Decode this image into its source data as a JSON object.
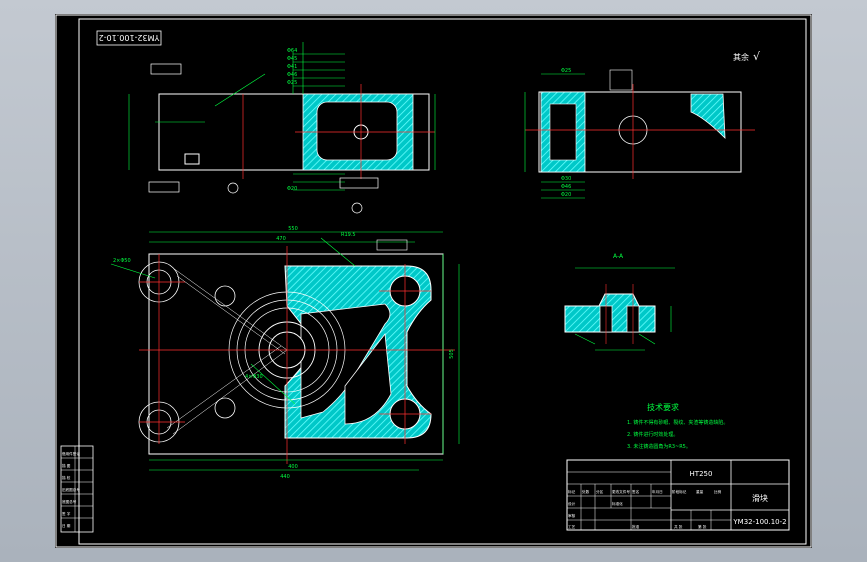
{
  "drawing": {
    "mirrored_code": "YM32-100.10-2",
    "roughness_note": "其余",
    "roughness_value": "√",
    "top_dims": [
      "Φ64",
      "Φ45",
      "Φ41",
      "Φ46",
      "Φ25",
      "Φ20"
    ],
    "plan_dims": [
      "550",
      "470",
      "400",
      "440",
      "505",
      "R19.5",
      "2×Φ50",
      "4×Φ30"
    ],
    "side_dims": [
      "Φ25",
      "Φ30",
      "Φ46",
      "Φ20"
    ],
    "section_label": "A-A",
    "tech_req": {
      "title": "技术要求",
      "items": [
        "1. 铸件不得有砂眼、裂纹、夹渣等铸造缺陷。",
        "2. 铸件进行时效处理。",
        "3. 未注铸造圆角为R3~R5。"
      ]
    },
    "title_block": {
      "material": "HT250",
      "part_name": "滑块",
      "drawing_number": "YM32-100.10-2",
      "cells": [
        "标记",
        "处数",
        "分区",
        "更改文件号",
        "签名",
        "年月日",
        "设计",
        "标准化",
        "审核",
        "工艺",
        "批准",
        "阶段标记",
        "重量",
        "比例",
        "共 张",
        "第 张"
      ]
    },
    "side_table": [
      "借用件登记",
      "描 图",
      "描 校",
      "旧底图总号",
      "底图总号",
      "签 字",
      "日 期"
    ]
  }
}
